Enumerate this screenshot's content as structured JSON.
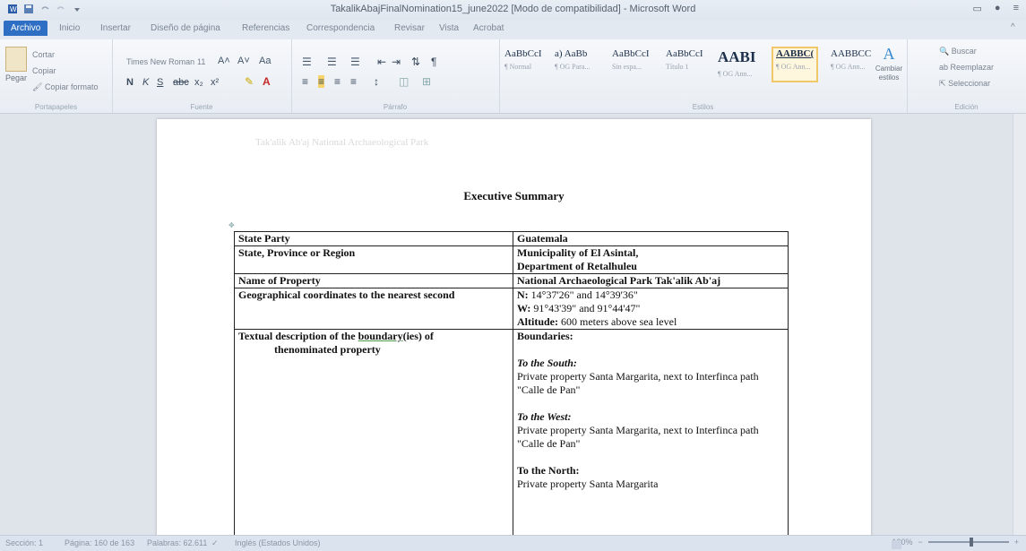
{
  "window": {
    "title": "TakalikAbajFinalNomination15_june2022 [Modo de compatibilidad] - Microsoft Word"
  },
  "tabs": [
    "Archivo",
    "Inicio",
    "Insertar",
    "Diseño de página",
    "Referencias",
    "Correspondencia",
    "Revisar",
    "Vista",
    "Acrobat"
  ],
  "ribbon": {
    "clipboard": {
      "paste": "Pegar",
      "cut": "Cortar",
      "copy": "Copiar",
      "format_painter": "Copiar formato",
      "label": "Portapapeles"
    },
    "font": {
      "name": "Times New Roman",
      "size": "11",
      "label": "Fuente"
    },
    "paragraph": {
      "label": "Párrafo"
    },
    "styles": {
      "items": [
        {
          "sample": "AaBbCcI",
          "name": "¶ Normal"
        },
        {
          "sample": "a) AaBb",
          "name": "¶ OG Para..."
        },
        {
          "sample": "AaBbCcI",
          "name": "Sin espa..."
        },
        {
          "sample": "AaBbCcI",
          "name": "Título 1"
        },
        {
          "sample": "AABI",
          "name": "¶ OG Ann..."
        },
        {
          "sample": "AABBC(",
          "name": "¶ OG Ann..."
        },
        {
          "sample": "AABBCC",
          "name": "¶ OG Ann..."
        }
      ],
      "change": "Cambiar estilos",
      "label": "Estilos"
    },
    "editing": {
      "find": "Buscar",
      "replace": "Reemplazar",
      "select": "Seleccionar",
      "label": "Edición"
    }
  },
  "document": {
    "header_faint": "Tak'alik Ab'aj National Archaeological Park",
    "title": "Executive Summary",
    "rows": [
      {
        "key": "State Party",
        "value": "Guatemala"
      },
      {
        "key": "State, Province or Region",
        "value_line1": "Municipality of El Asintal,",
        "value_line2": "Department of Retalhuleu"
      },
      {
        "key": "Name of Property",
        "value": "National Archaeological Park Tak'alik Ab'aj"
      },
      {
        "key": "Geographical coordinates to the nearest second",
        "n_label": "N:",
        "n_value": "14°37'26\" and 14°39'36\"",
        "w_label": "W:",
        "w_value": "91°43'39\" and 91°44'47\"",
        "alt_label": "Altitude:",
        "alt_value": "600 meters above sea level"
      },
      {
        "key_part1": "Textual description of the ",
        "key_underlined": "boundary",
        "key_part2": "(ies) of",
        "key_line2": "thenominated property",
        "boundaries_label": "Boundaries:",
        "south_label": "To the South:",
        "south_text": "Private property Santa Margarita, next to Interfinca path \"Calle de Pan\"",
        "west_label": "To the West:",
        "west_text": "Private property Santa Margarita, next to Interfinca path \"Calle de Pan\"",
        "north_label": "To the North:",
        "north_text": "Private property Santa Margarita"
      }
    ]
  },
  "status": {
    "section": "Sección: 1",
    "page": "Página: 160 de 163",
    "words": "Palabras: 62.611",
    "language": "Inglés (Estados Unidos)",
    "zoom": "120%"
  }
}
